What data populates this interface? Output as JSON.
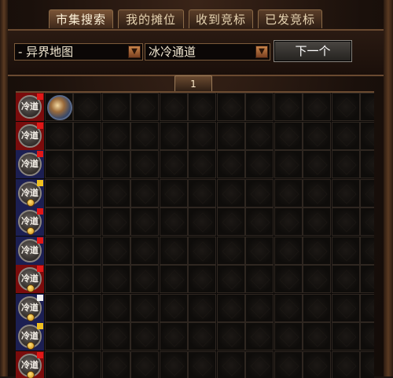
{
  "tabs": [
    {
      "label": "市集搜索",
      "active": true
    },
    {
      "label": "我的摊位",
      "active": false
    },
    {
      "label": "收到竞标",
      "active": false
    },
    {
      "label": "已发竞标",
      "active": false
    }
  ],
  "filters": {
    "map_select": "- 异界地图",
    "area_select": "冰冷通道"
  },
  "next_button": "下一个",
  "page": "1",
  "rows": [
    {
      "badge_text": "冷道",
      "tag_color": "red",
      "flag": "red",
      "coin": false,
      "has_item": true
    },
    {
      "badge_text": "冷道",
      "tag_color": "red",
      "flag": "red",
      "coin": false,
      "has_item": false
    },
    {
      "badge_text": "冷道",
      "tag_color": "blue",
      "flag": "red",
      "coin": false,
      "has_item": false
    },
    {
      "badge_text": "冷道",
      "tag_color": "blue",
      "flag": "yellow",
      "coin": true,
      "has_item": false
    },
    {
      "badge_text": "冷道",
      "tag_color": "blue",
      "flag": "red",
      "coin": true,
      "has_item": false
    },
    {
      "badge_text": "冷道",
      "tag_color": "blue",
      "flag": "red",
      "coin": false,
      "has_item": false
    },
    {
      "badge_text": "冷道",
      "tag_color": "red",
      "flag": "red",
      "coin": true,
      "has_item": false
    },
    {
      "badge_text": "冷道",
      "tag_color": "blue",
      "flag": "white",
      "coin": true,
      "has_item": false
    },
    {
      "badge_text": "冷道",
      "tag_color": "blue",
      "flag": "yellow",
      "coin": true,
      "has_item": false
    },
    {
      "badge_text": "冷道",
      "tag_color": "red",
      "flag": "red",
      "coin": true,
      "has_item": false
    }
  ],
  "colors": {
    "panel_border": "#6a4a30",
    "tab_text": "#e7d4b2",
    "flag_red": "#e01818",
    "flag_yellow": "#f0c020"
  },
  "icons": {
    "dropdown": "chevron-down-icon",
    "coin": "gold-coin-icon",
    "item": "map-orb-icon"
  }
}
